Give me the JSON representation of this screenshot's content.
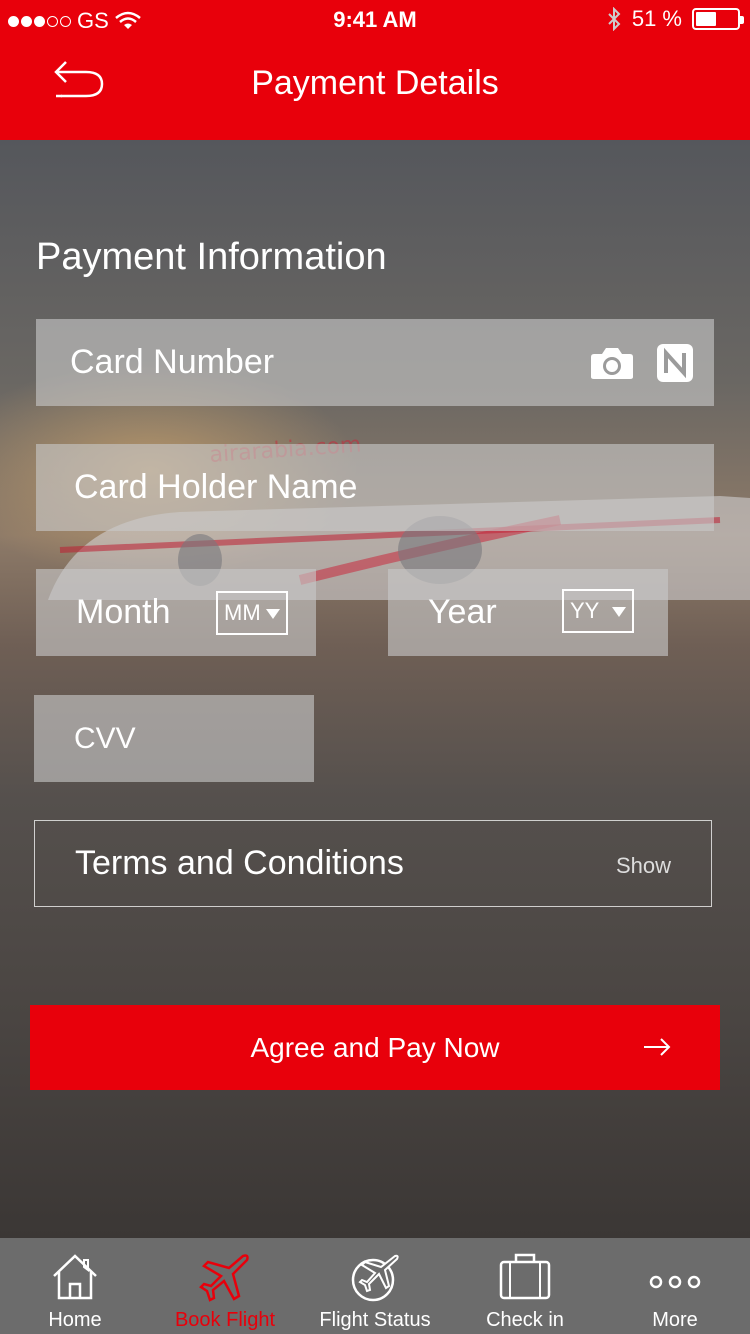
{
  "status_bar": {
    "carrier": "GS",
    "time": "9:41 AM",
    "battery_percent": "51 %",
    "battery_level": 0.51,
    "signal_bars": 3,
    "signal_total": 5
  },
  "header": {
    "title": "Payment Details",
    "back_icon": "undo-arrow-icon",
    "color": "#e8000b"
  },
  "form": {
    "section_title": "Payment Information",
    "card_number_placeholder": "Card Number",
    "card_icons": [
      "camera-icon",
      "nfc-icon"
    ],
    "holder_name_placeholder": "Card Holder Name",
    "month_label": "Month",
    "month_select": "MM",
    "year_label": "Year",
    "year_select": "YY",
    "cvv_placeholder": "CVV",
    "terms_label": "Terms and Conditions",
    "terms_action": "Show"
  },
  "pay_button": {
    "label": "Agree and Pay Now",
    "icon": "arrow-right-icon"
  },
  "tabbar": {
    "active_color": "#e8000b",
    "items": [
      {
        "label": "Home",
        "icon": "home-icon"
      },
      {
        "label": "Book Flight",
        "icon": "plane-icon",
        "active": true
      },
      {
        "label": "Flight Status",
        "icon": "flight-status-icon"
      },
      {
        "label": "Check in",
        "icon": "luggage-icon"
      },
      {
        "label": "More",
        "icon": "more-dots-icon"
      }
    ]
  },
  "background": {
    "aircraft_livery_text": "airarabia.com"
  }
}
